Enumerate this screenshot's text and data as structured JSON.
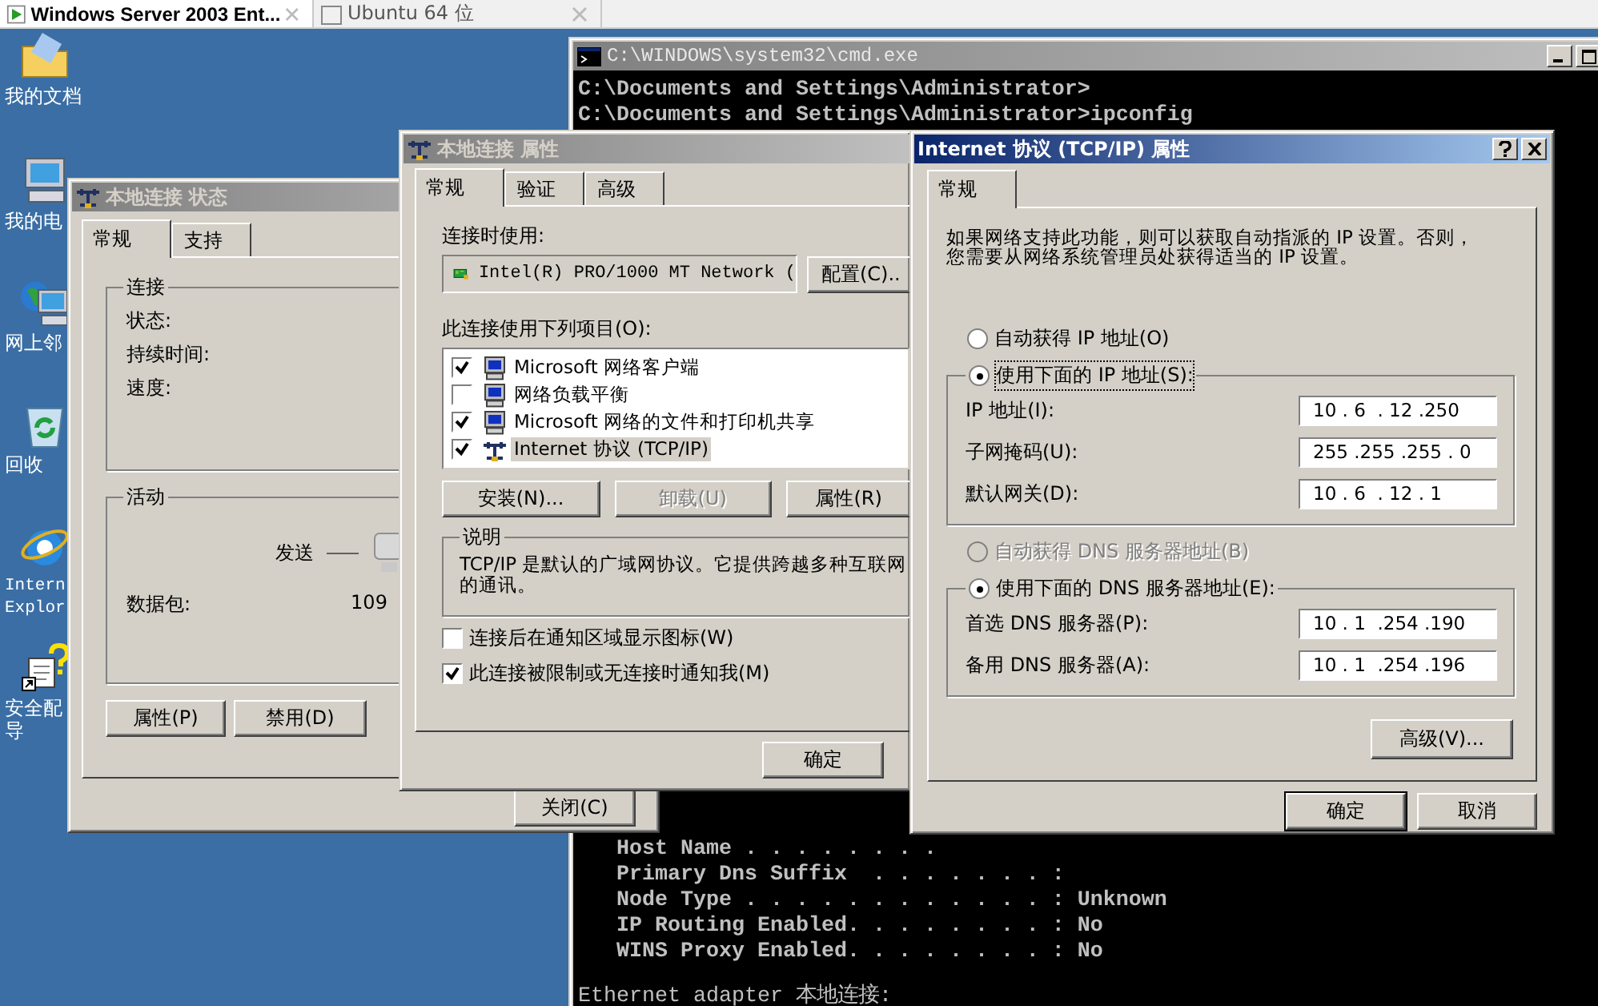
{
  "vm_tabs": [
    {
      "label": "Windows Server 2003 Ent...",
      "selected": true
    },
    {
      "label": "Ubuntu 64 位",
      "selected": false
    }
  ],
  "desktop_icons": [
    {
      "kind": "documents",
      "lines": [
        "我的文档"
      ]
    },
    {
      "kind": "computer",
      "lines": [
        "我的电"
      ]
    },
    {
      "kind": "network",
      "lines": [
        "网上邻"
      ]
    },
    {
      "kind": "recycle",
      "lines": [
        "回收"
      ]
    },
    {
      "kind": "browser",
      "lines": [
        "Intern",
        "Explor"
      ]
    },
    {
      "kind": "help",
      "lines": [
        "安全配",
        "导"
      ]
    }
  ],
  "cmd_window": {
    "title": "C:\\WINDOWS\\system32\\cmd.exe",
    "top_lines": [
      "C:\\Documents and Settings\\Administrator>",
      "C:\\Documents and Settings\\Administrator>ipconfig"
    ],
    "bottom_lines": [
      "   Host Name . . . . . . . .",
      "   Primary Dns Suffix  . . . . . . . :",
      "   Node Type . . . . . . . . . . . . : Unknown",
      "   IP Routing Enabled. . . . . . . . : No",
      "   WINS Proxy Enabled. . . . . . . . : No"
    ],
    "last_line": "Ethernet adapter 本地连接:"
  },
  "status_dialog": {
    "title": "本地连接 状态",
    "tabs": [
      {
        "label": "常规",
        "selected": true
      },
      {
        "label": "支持",
        "selected": false
      }
    ],
    "connection_group": {
      "title": "连接",
      "labels": [
        "状态:",
        "持续时间:",
        "速度:"
      ]
    },
    "activity_group": {
      "title": "活动",
      "sent_label": "发送",
      "packets_label": "数据包:",
      "packets_value": "109"
    },
    "buttons": [
      "属性(P)",
      "禁用(D)"
    ],
    "close_button": "关闭(C)"
  },
  "properties_dialog": {
    "title": "本地连接 属性",
    "tabs": [
      {
        "label": "常规",
        "selected": true
      },
      {
        "label": "验证",
        "selected": false
      },
      {
        "label": "高级",
        "selected": false
      }
    ],
    "connect_using_label": "连接时使用:",
    "adapter": "Intel(R) PRO/1000 MT Network (",
    "configure_button": "配置(C)..",
    "items_label": "此连接使用下列项目(O):",
    "items": [
      {
        "kind": "client",
        "label": "Microsoft 网络客户端",
        "checked": true,
        "selected": false
      },
      {
        "kind": "service",
        "label": "网络负载平衡",
        "checked": false,
        "selected": false
      },
      {
        "kind": "service",
        "label": "Microsoft 网络的文件和打印机共享",
        "checked": true,
        "selected": false
      },
      {
        "kind": "protocol",
        "label": "Internet 协议 (TCP/IP)",
        "checked": true,
        "selected": true
      }
    ],
    "item_buttons": [
      {
        "label": "安装(N)...",
        "disabled": false
      },
      {
        "label": "卸载(U)",
        "disabled": true
      },
      {
        "label": "属性(R)",
        "disabled": false
      }
    ],
    "description_title": "说明",
    "description_lines": [
      "TCP/IP 是默认的广域网协议。它提供跨越多种互联网",
      "的通讯。"
    ],
    "options": [
      {
        "label": "连接后在通知区域显示图标(W)",
        "checked": false
      },
      {
        "label": "此连接被限制或无连接时通知我(M)",
        "checked": true
      }
    ],
    "ok_button": "确定"
  },
  "tcpip_dialog": {
    "title": "Internet 协议 (TCP/IP) 属性",
    "tabs": [
      {
        "label": "常规",
        "selected": true
      }
    ],
    "intro_lines": [
      "如果网络支持此功能，则可以获取自动指派的 IP 设置。否则，",
      "您需要从网络系统管理员处获得适当的 IP 设置。"
    ],
    "ip_radios": [
      {
        "label": "自动获得 IP 地址(O)",
        "selected": false,
        "disabled": false
      },
      {
        "label": "使用下面的 IP 地址(S):",
        "selected": true,
        "disabled": false
      }
    ],
    "ip_fields": [
      {
        "label": "IP 地址(I):",
        "value": "10 . 6  . 12 .250"
      },
      {
        "label": "子网掩码(U):",
        "value": "255 .255 .255 . 0"
      },
      {
        "label": "默认网关(D):",
        "value": "10 . 6  . 12 . 1"
      }
    ],
    "dns_radios": [
      {
        "label": "自动获得 DNS 服务器地址(B)",
        "selected": false,
        "disabled": true
      },
      {
        "label": "使用下面的 DNS 服务器地址(E):",
        "selected": true,
        "disabled": false
      }
    ],
    "dns_fields": [
      {
        "label": "首选 DNS 服务器(P):",
        "value": "10 . 1  .254 .190"
      },
      {
        "label": "备用 DNS 服务器(A):",
        "value": "10 . 1  .254 .196"
      }
    ],
    "advanced_button": "高级(V)...",
    "ok_button": "确定",
    "cancel_button": "取消"
  }
}
